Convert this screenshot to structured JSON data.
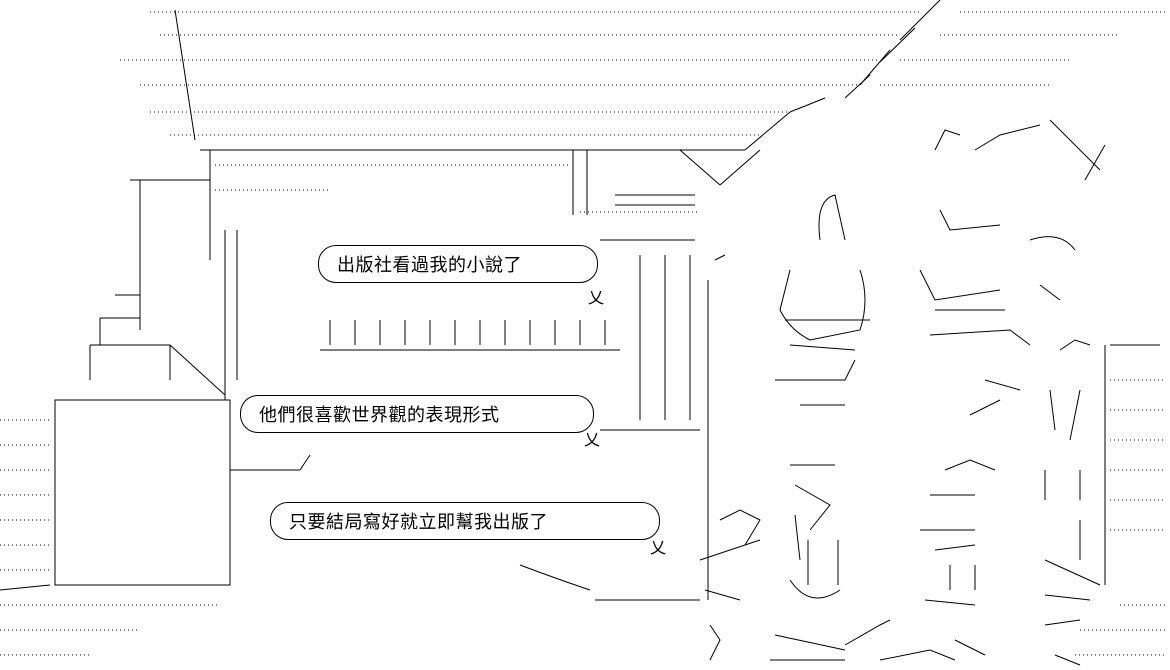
{
  "speech_bubbles": [
    {
      "text": "出版社看過我的小說了"
    },
    {
      "text": "他們很喜歡世界觀的表現形式"
    },
    {
      "text": "只要結局寫好就立即幫我出版了"
    }
  ]
}
